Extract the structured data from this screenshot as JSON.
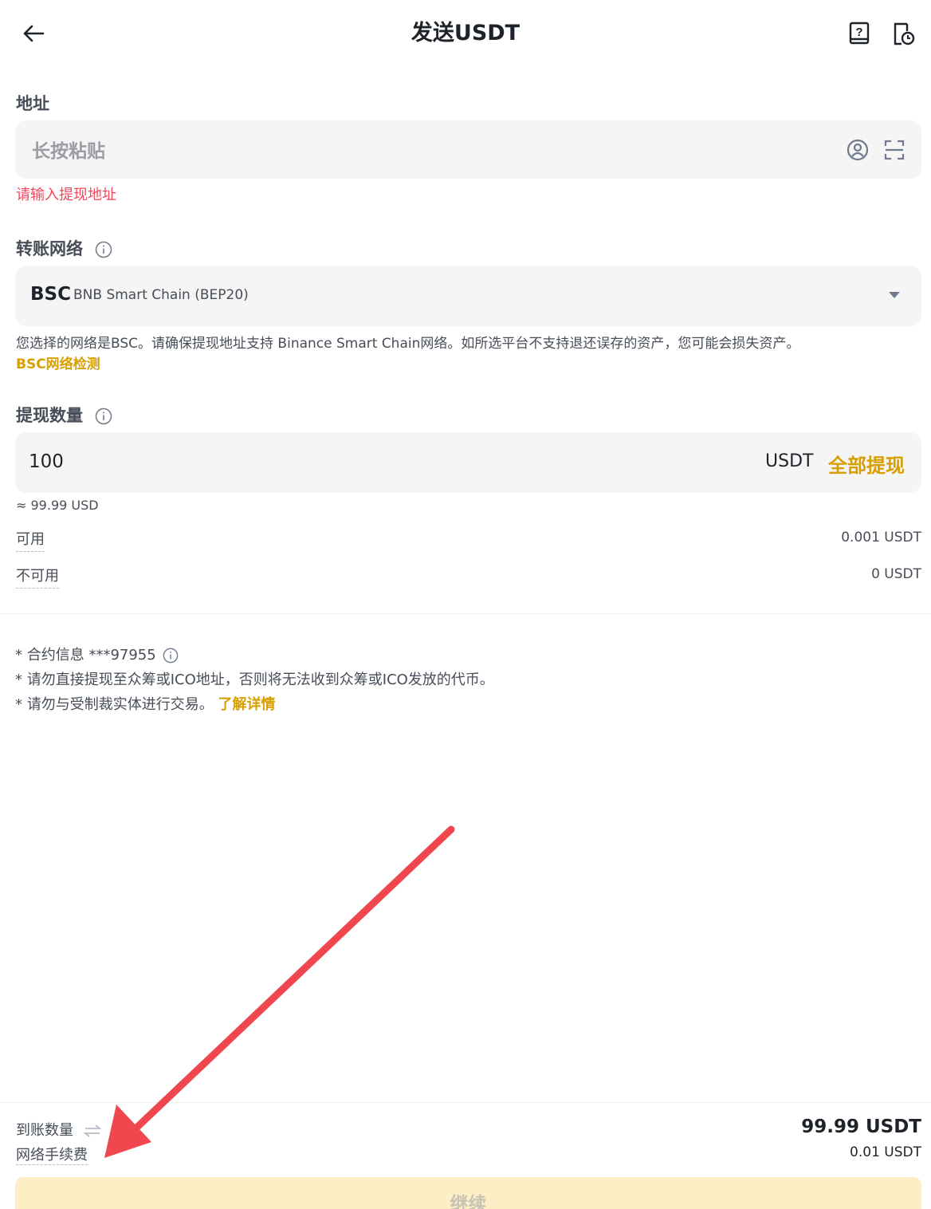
{
  "header": {
    "title": "发送USDT"
  },
  "address": {
    "label": "地址",
    "placeholder": "长按粘贴",
    "error": "请输入提现地址"
  },
  "network": {
    "label": "转账网络",
    "code": "BSC",
    "name": "BNB Smart Chain (BEP20)",
    "notice": "您选择的网络是BSC。请确保提现地址支持 Binance Smart Chain网络。如所选平台不支持退还误存的资产，您可能会损失资产。",
    "check_link": "BSC网络检测"
  },
  "amount": {
    "label": "提现数量",
    "value": "100",
    "unit": "USDT",
    "withdraw_all": "全部提现",
    "usd_approx": "≈ 99.99 USD",
    "available_label": "可用",
    "available_value": "0.001 USDT",
    "unavailable_label": "不可用",
    "unavailable_value": "0 USDT"
  },
  "notes": {
    "contract": "* 合约信息 ***97955",
    "warning_ico": "* 请勿直接提现至众筹或ICO地址，否则将无法收到众筹或ICO发放的代币。",
    "warning_sanction": "* 请勿与受制裁实体进行交易。",
    "learn_more": "了解详情"
  },
  "summary": {
    "received_label": "到账数量",
    "received_value": "99.99 USDT",
    "fee_label": "网络手续费",
    "fee_value": "0.01 USDT"
  },
  "footer": {
    "continue_label": "继续"
  },
  "colors": {
    "accent": "#d89f00",
    "error": "#f6465d",
    "annotation_arrow": "#f0474f"
  },
  "icons": [
    "back-arrow-icon",
    "help-book-icon",
    "history-clock-icon",
    "contact-icon",
    "scan-icon",
    "info-icon",
    "chevron-down-icon",
    "swap-icon"
  ]
}
